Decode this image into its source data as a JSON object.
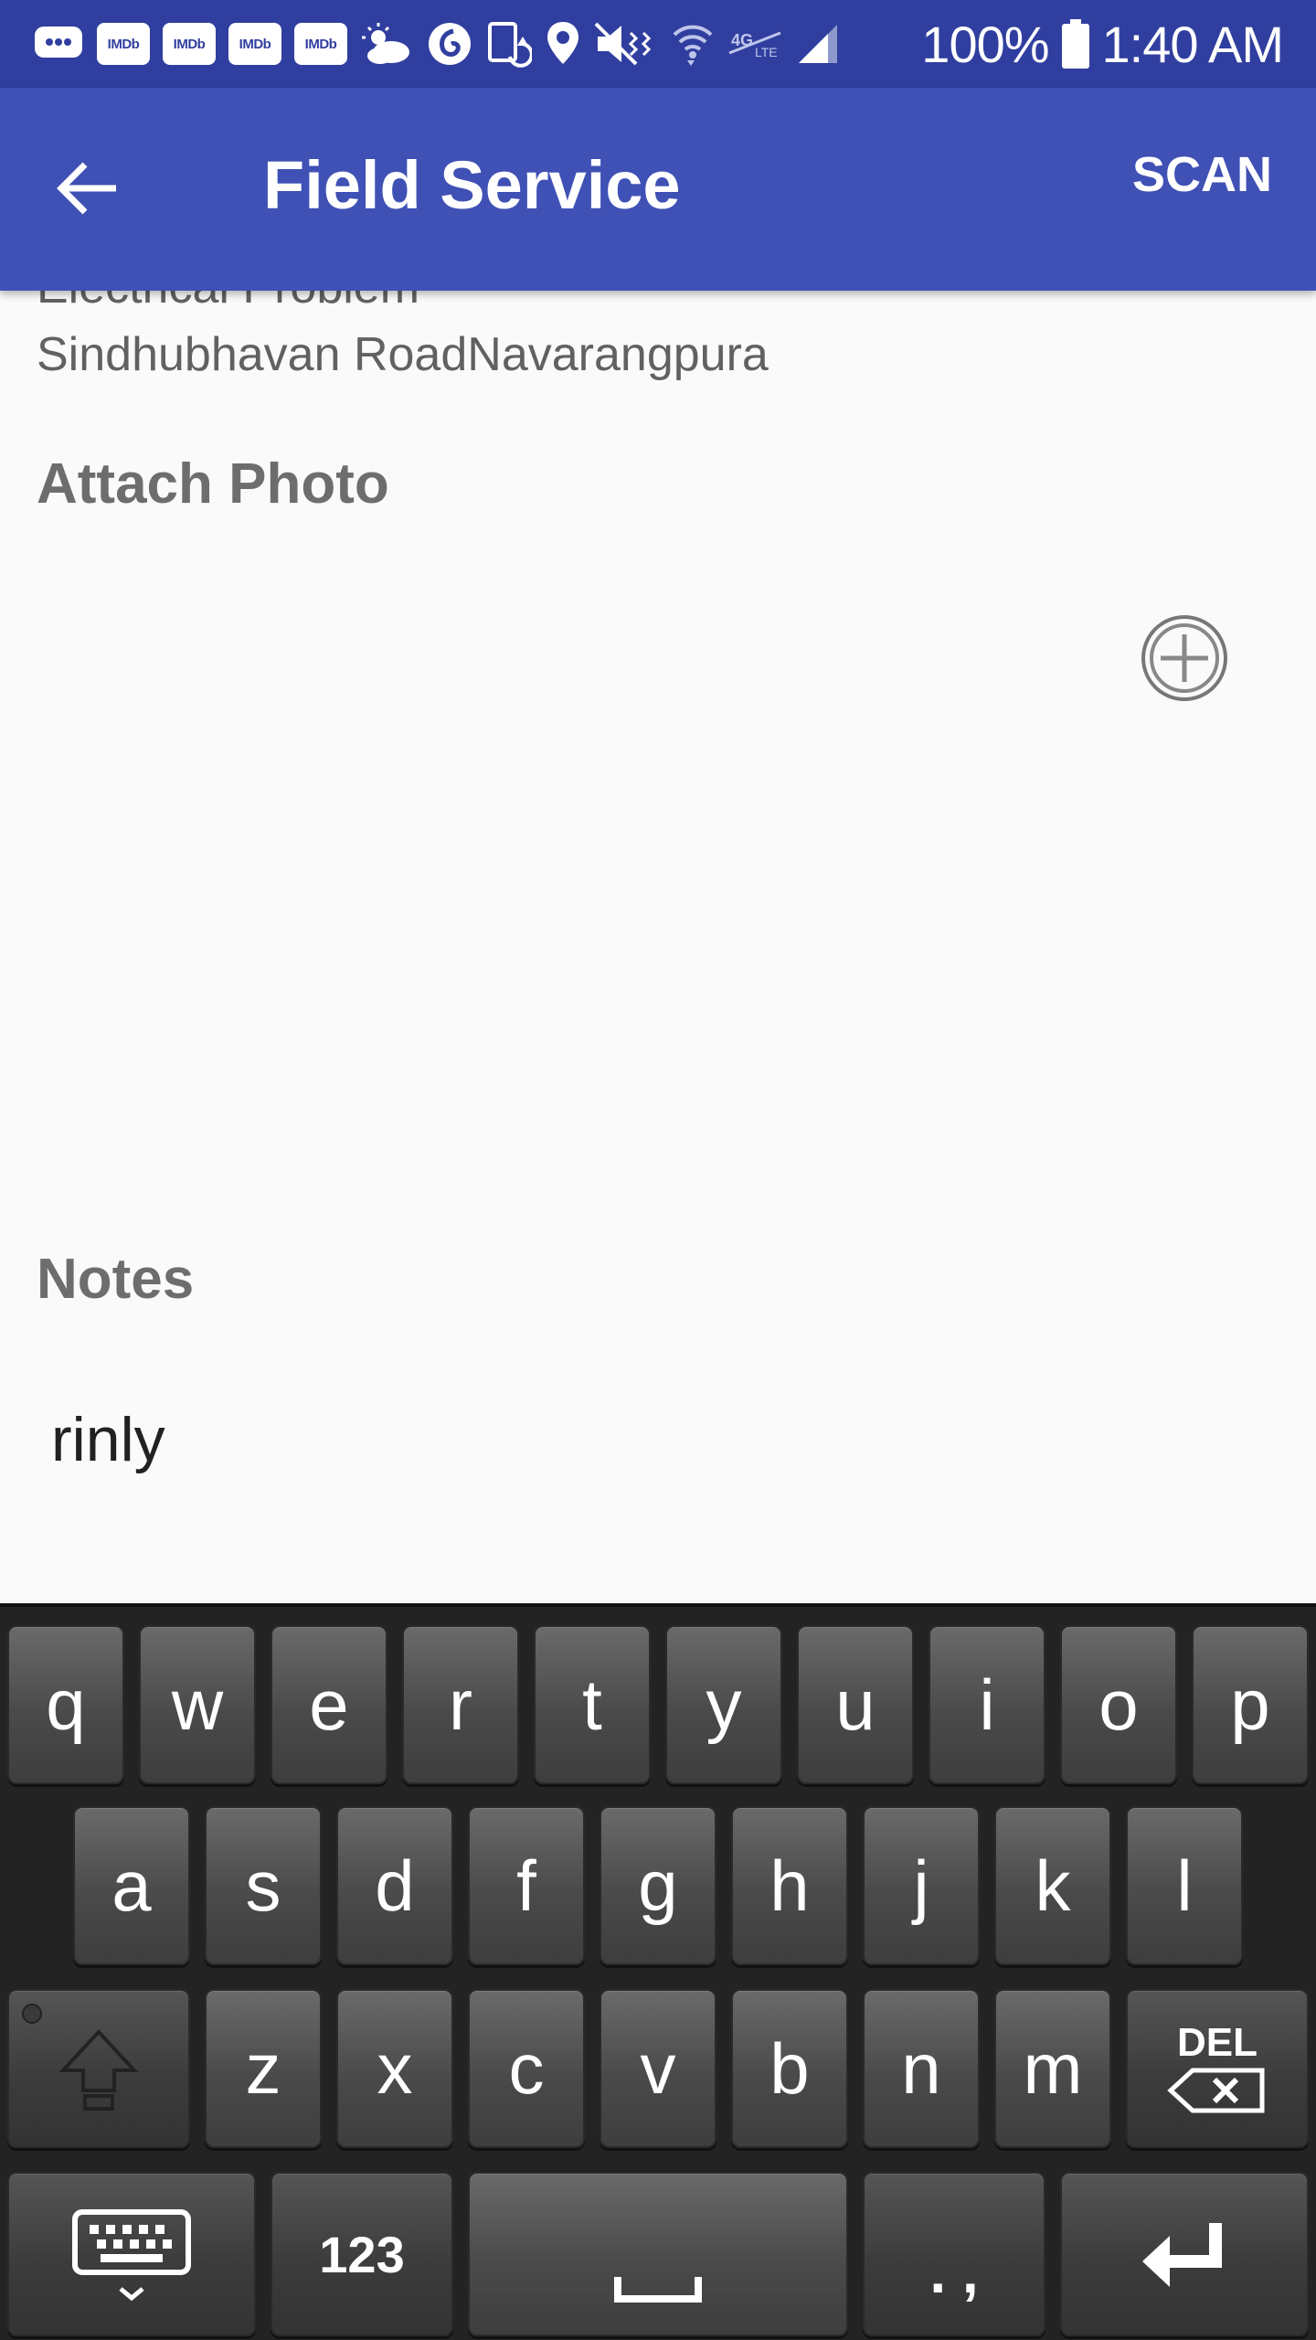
{
  "status_bar": {
    "notification_badges": [
      "IMDb",
      "IMDb",
      "IMDb",
      "IMDb"
    ],
    "battery": "100%",
    "time": "1:40 AM",
    "icons": [
      "message-icon",
      "weather-icon",
      "vodafone-icon",
      "screen-rotation-icon",
      "location-icon",
      "mute-icon",
      "wifi-icon",
      "no-sim-icon",
      "signal-icon",
      "battery-icon"
    ]
  },
  "app_bar": {
    "title": "Field Service",
    "action": "SCAN",
    "back_icon": "arrow-left-icon",
    "color": "#3f51b5"
  },
  "details": {
    "problem_type": "Electrical Problem",
    "address": "Sindhubhavan RoadNavarangpura"
  },
  "attach_photo": {
    "label": "Attach Photo",
    "add_icon": "add-circle-icon"
  },
  "notes": {
    "label": "Notes",
    "value": "rinly"
  },
  "keyboard": {
    "row1": [
      "q",
      "w",
      "e",
      "r",
      "t",
      "y",
      "u",
      "i",
      "o",
      "p"
    ],
    "row2": [
      "a",
      "s",
      "d",
      "f",
      "g",
      "h",
      "j",
      "k",
      "l"
    ],
    "row3": [
      "z",
      "x",
      "c",
      "v",
      "b",
      "n",
      "m"
    ],
    "delete_label": "DEL",
    "numbers_label": "123",
    "punctuation_label": ". ,"
  }
}
